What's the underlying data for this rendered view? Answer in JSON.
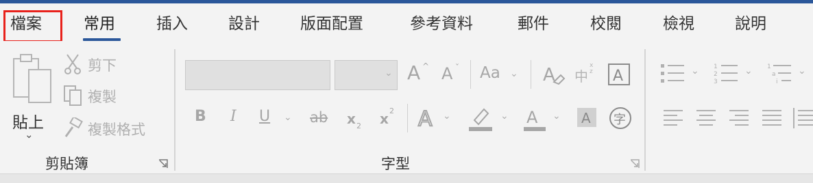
{
  "tabs": [
    {
      "label": "檔案"
    },
    {
      "label": "常用"
    },
    {
      "label": "插入"
    },
    {
      "label": "設計"
    },
    {
      "label": "版面配置"
    },
    {
      "label": "參考資料"
    },
    {
      "label": "郵件"
    },
    {
      "label": "校閱"
    },
    {
      "label": "檢視"
    },
    {
      "label": "說明"
    }
  ],
  "active_tab": "常用",
  "clipboard": {
    "paste_label": "貼上",
    "cut_label": "剪下",
    "copy_label": "複製",
    "format_painter_label": "複製格式",
    "group_label": "剪貼簿"
  },
  "font": {
    "font_name": "",
    "font_size": "",
    "group_label": "字型",
    "change_case_label": "Aa",
    "subscript_label": "x",
    "subscript_sub": "2",
    "superscript_label": "x",
    "superscript_sup": "2",
    "phonetic_label": "中",
    "enclose_label": "字"
  },
  "colors": {
    "accent": "#2b579a",
    "highlight_border": "#e8211b",
    "disabled": "#a6a6a6"
  }
}
